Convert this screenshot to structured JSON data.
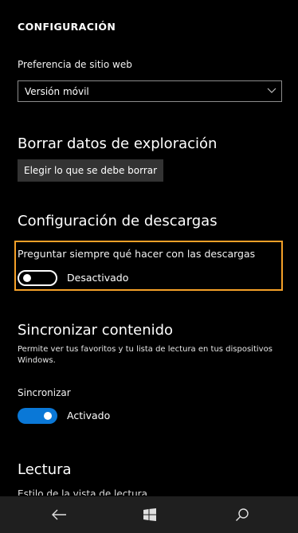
{
  "header": {
    "title": "CONFIGURACIÓN"
  },
  "website_preference": {
    "label": "Preferencia de sitio web",
    "selected_value": "Versión móvil"
  },
  "clear_data": {
    "title": "Borrar datos de exploración",
    "button_label": "Elegir lo que se debe borrar"
  },
  "downloads": {
    "title": "Configuración de descargas",
    "ask_label": "Preguntar siempre qué hacer con las descargas",
    "toggle_state": "Desactivado",
    "toggle_on": false
  },
  "sync": {
    "title": "Sincronizar contenido",
    "description": "Permite ver tus favoritos y tu lista de lectura en tus dispositivos Windows.",
    "label": "Sincronizar",
    "toggle_state": "Activado",
    "toggle_on": true
  },
  "reading": {
    "title": "Lectura",
    "view_style_label": "Estilo de la vista de lectura"
  },
  "navbar": {
    "items": [
      "back-icon",
      "windows-icon",
      "search-icon"
    ]
  },
  "colors": {
    "accent": "#0a78d7",
    "highlight": "#f5a028",
    "background": "#000000",
    "button_bg": "#333333",
    "navbar_bg": "#1f1f1f"
  }
}
